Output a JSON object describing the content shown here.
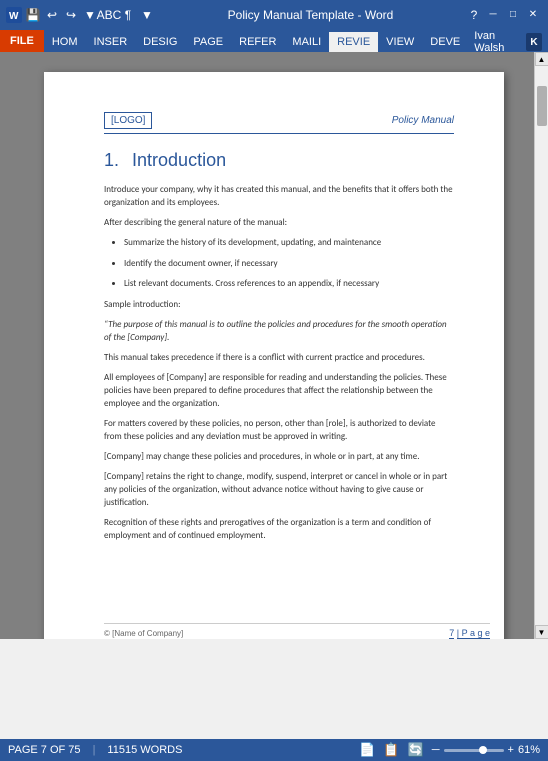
{
  "titleBar": {
    "title": "Policy Manual Template - Word",
    "questionMark": "?",
    "minimize": "─",
    "maximize": "□",
    "close": "✕"
  },
  "ribbonTabs": {
    "file": "FILE",
    "tabs": [
      "HOM",
      "INSER",
      "DESIG",
      "PAGE",
      "REFER",
      "MAILI",
      "REVIE",
      "VIEW",
      "DEVE"
    ]
  },
  "user": {
    "name": "Ivan Walsh",
    "initial": "K"
  },
  "pageHeader": {
    "logo": "[LOGO]",
    "title": "Policy Manual"
  },
  "section": {
    "number": "1.",
    "heading": "Introduction",
    "paragraphs": [
      "Introduce your company, why it has created this manual, and the benefits that it offers both the organization and its employees.",
      "After describing the general nature of the manual:"
    ],
    "bullets": [
      "Summarize the history of its development, updating, and maintenance",
      "Identify the document owner, if necessary",
      "List relevant documents. Cross references to an appendix, if necessary"
    ],
    "sampleLabel": "Sample introduction:",
    "sampleText": "“The purpose of this manual is to outline the policies and procedures for the smooth operation of the [Company].",
    "para3": "This manual takes precedence if there is a conflict with current practice and procedures.",
    "para4": "All employees of [Company] are responsible for reading and understanding the policies. These policies have been prepared to define procedures that affect the relationship between the employee and the organization.",
    "para5": "For matters covered by these policies, no person, other than [role], is authorized to deviate from these policies and any deviation must be approved in writing.",
    "para6": "[Company] may change these policies and procedures, in whole or in part, at any time.",
    "para7": "[Company] retains the right to change, modify, suspend, interpret or cancel in whole or in part any policies of the organization, without advance notice without having to give cause or justification.",
    "para8": "Recognition of these rights and prerogatives of the organization is a term and condition of employment and of continued employment."
  },
  "pageFooter": {
    "company": "© [Name of Company]",
    "pageNum": "7",
    "pageText": "P a g e"
  },
  "statusBar": {
    "page": "PAGE 7 OF 75",
    "words": "11515 WORDS",
    "zoom": "61%",
    "icons": [
      "📄",
      "📋",
      "🔄"
    ]
  }
}
